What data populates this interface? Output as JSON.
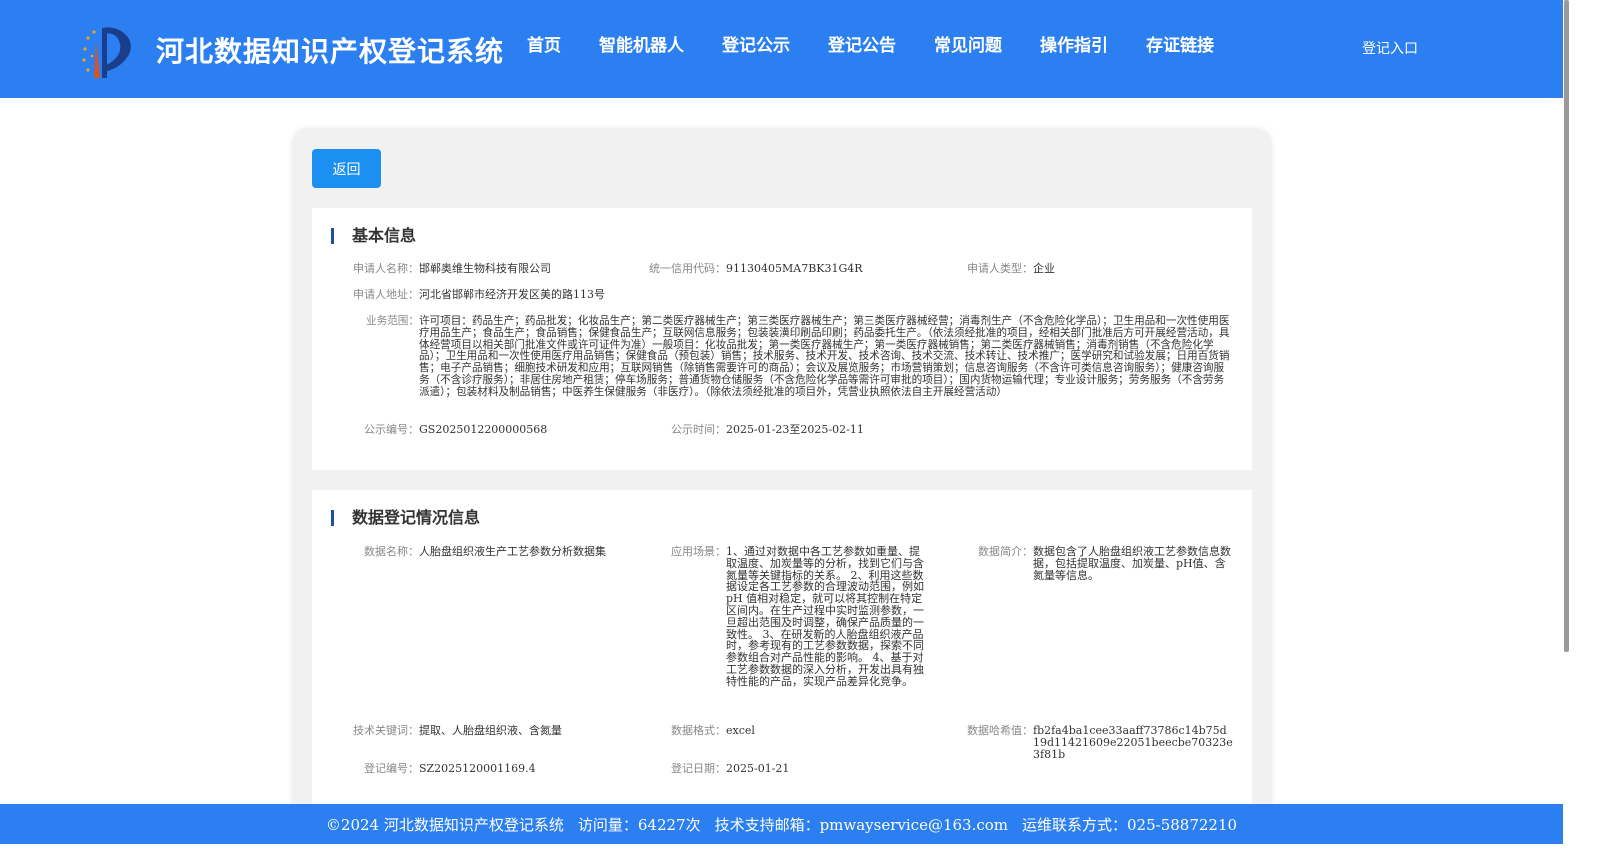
{
  "header": {
    "site_title": "河北数据知识产权登记系统",
    "nav": [
      "首页",
      "智能机器人",
      "登记公示",
      "登记公告",
      "常见问题",
      "操作指引",
      "存证链接"
    ],
    "login": "登记入口"
  },
  "back_button": "返回",
  "basic_info": {
    "title": "基本信息",
    "applicant_name": {
      "label": "申请人名称：",
      "value": "邯郸奥维生物科技有限公司"
    },
    "credit_code": {
      "label": "统一信用代码：",
      "value": "91130405MA7BK31G4R"
    },
    "applicant_type": {
      "label": "申请人类型：",
      "value": "企业"
    },
    "applicant_address": {
      "label": "申请人地址：",
      "value": "河北省邯郸市经济开发区美的路113号"
    },
    "business_scope": {
      "label": "业务范围：",
      "value": "许可项目：药品生产；药品批发；化妆品生产；第二类医疗器械生产；第三类医疗器械生产；第三类医疗器械经营；消毒剂生产（不含危险化学品）；卫生用品和一次性使用医疗用品生产；食品生产；食品销售；保健食品生产；互联网信息服务；包装装潢印刷品印刷；药品委托生产。（依法须经批准的项目，经相关部门批准后方可开展经营活动，具体经营项目以相关部门批准文件或许可证件为准）一般项目：化妆品批发；第一类医疗器械生产；第一类医疗器械销售；第二类医疗器械销售；消毒剂销售（不含危险化学品）；卫生用品和一次性使用医疗用品销售；保健食品（预包装）销售；技术服务、技术开发、技术咨询、技术交流、技术转让、技术推广；医学研究和试验发展；日用百货销售；电子产品销售；细胞技术研发和应用；互联网销售（除销售需要许可的商品）；会议及展览服务；市场营销策划；信息咨询服务（不含许可类信息咨询服务）；健康咨询服务（不含诊疗服务）；非居住房地产租赁；停车场服务；普通货物仓储服务（不含危险化学品等需许可审批的项目）；国内货物运输代理；专业设计服务；劳务服务（不含劳务派遣）；包装材料及制品销售；中医养生保健服务（非医疗）。（除依法须经批准的项目外，凭营业执照依法自主开展经营活动）"
    },
    "publicity_no": {
      "label": "公示编号：",
      "value": "GS2025012200000568"
    },
    "publicity_time": {
      "label": "公示时间：",
      "value": "2025-01-23至2025-02-11"
    }
  },
  "data_info": {
    "title": "数据登记情况信息",
    "data_name": {
      "label": "数据名称：",
      "value": "人胎盘组织液生产工艺参数分析数据集"
    },
    "scenario": {
      "label": "应用场景：",
      "value": "1、通过对数据中各工艺参数如重量、提取温度、加炭量等的分析，找到它们与含氮量等关键指标的关系。 2、利用这些数据设定各工艺参数的合理波动范围，例如 pH 值相对稳定，就可以将其控制在特定区间内。在生产过程中实时监测参数，一旦超出范围及时调整，确保产品质量的一致性。 3、在研发新的人胎盘组织液产品时，参考现有的工艺参数数据，探索不同参数组合对产品性能的影响。 4、基于对工艺参数数据的深入分析，开发出具有独特性能的产品，实现产品差异化竞争。"
    },
    "summary": {
      "label": "数据简介：",
      "value": "数据包含了人胎盘组织液工艺参数信息数据，包括提取温度、加炭量、pH值、含氮量等信息。"
    },
    "keywords": {
      "label": "技术关键词：",
      "value": "提取、人胎盘组织液、含氮量"
    },
    "format": {
      "label": "数据格式：",
      "value": "excel"
    },
    "hash": {
      "label": "数据哈希值：",
      "value": "fb2fa4ba1cee33aaff73786c14b75d19d11421609e22051beecbe70323e3f81b"
    },
    "reg_no": {
      "label": "登记编号：",
      "value": "SZ2025120001169.4"
    },
    "reg_date": {
      "label": "登记日期：",
      "value": "2025-01-21"
    }
  },
  "footer": {
    "copyright": "©2024 河北数据知识产权登记系统",
    "visits": "访问量：64227次",
    "email": "技术支持邮箱：pmwayservice@163.com",
    "phone": "运维联系方式：025-58872210"
  },
  "colors": {
    "header": "#2b7ff0",
    "button": "#1c8ff2",
    "title_bar": "#1f4fa3"
  },
  "icons": {
    "logo": "emblem-logo-icon"
  }
}
